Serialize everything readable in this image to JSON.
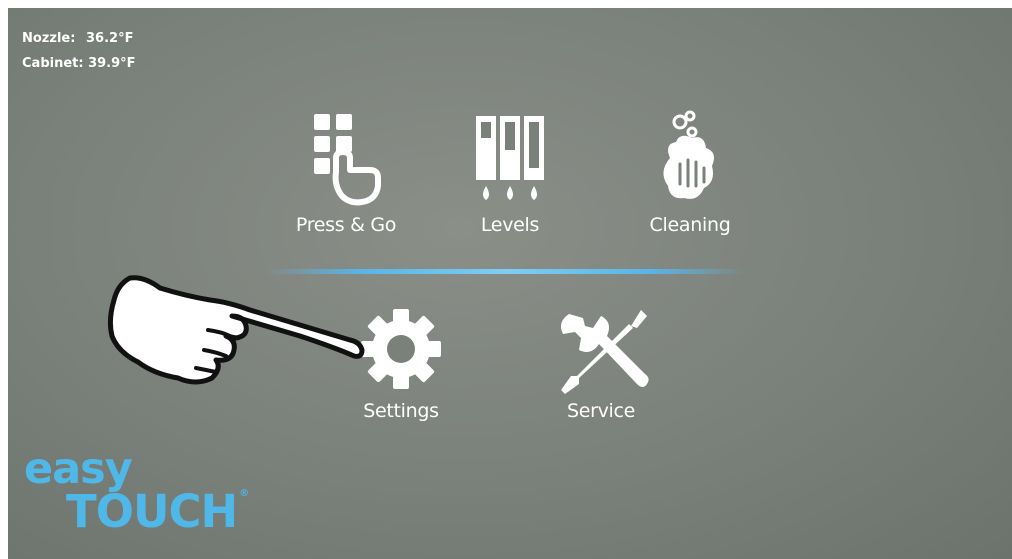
{
  "status": {
    "nozzle_label": "Nozzle:",
    "nozzle_value": "36.2°F",
    "cabinet_label": "Cabinet:",
    "cabinet_value": "39.9°F"
  },
  "menu": {
    "press_go": "Press & Go",
    "levels": "Levels",
    "cleaning": "Cleaning",
    "settings": "Settings",
    "service": "Service"
  },
  "brand": {
    "line1": "easy",
    "line2": "TOUCH",
    "reg_mark": "®",
    "color": "#4fb8e8"
  },
  "icons": {
    "press_go": "keypad-touch-icon",
    "levels": "tank-levels-icon",
    "cleaning": "hand-wash-icon",
    "settings": "gear-icon",
    "service": "wrench-screwdriver-icon",
    "pointer": "pointing-hand-icon"
  },
  "colors": {
    "screen_bg": "#7a807a",
    "divider": "#5ab4e6"
  }
}
